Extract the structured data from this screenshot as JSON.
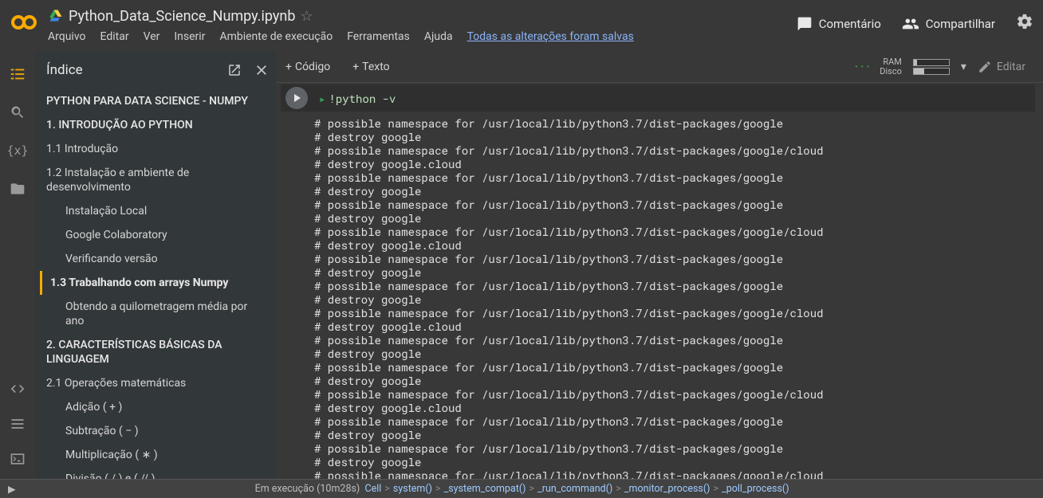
{
  "header": {
    "title": "Python_Data_Science_Numpy.ipynb",
    "menus": [
      "Arquivo",
      "Editar",
      "Ver",
      "Inserir",
      "Ambiente de execução",
      "Ferramentas",
      "Ajuda"
    ],
    "saved_msg": "Todas as alterações foram salvas",
    "comment": "Comentário",
    "share": "Compartilhar"
  },
  "toolbar": {
    "code": "Código",
    "text": "Texto",
    "ram": "RAM",
    "disk": "Disco",
    "edit": "Editar"
  },
  "sidebar": {
    "title": "Índice",
    "items": [
      {
        "lvl": 0,
        "label": "PYTHON PARA DATA SCIENCE - NUMPY"
      },
      {
        "lvl": 0,
        "label": "1. INTRODUÇÃO AO PYTHON"
      },
      {
        "lvl": 1,
        "label": "1.1 Introdução"
      },
      {
        "lvl": 1,
        "label": "1.2 Instalação e ambiente de desenvolvimento"
      },
      {
        "lvl": 2,
        "label": "Instalação Local"
      },
      {
        "lvl": 2,
        "label": "Google Colaboratory"
      },
      {
        "lvl": 2,
        "label": "Verificando versão"
      },
      {
        "lvl": 1,
        "label": "1.3 Trabalhando com arrays Numpy",
        "sel": true
      },
      {
        "lvl": 2,
        "label": "Obtendo a quilometragem média por ano"
      },
      {
        "lvl": 0,
        "label": "2. CARACTERÍSTICAS BÁSICAS DA LINGUAGEM"
      },
      {
        "lvl": 1,
        "label": "2.1 Operações matemáticas"
      },
      {
        "lvl": 2,
        "label": "Adição ( + )"
      },
      {
        "lvl": 2,
        "label": "Subtração ( − )"
      },
      {
        "lvl": 2,
        "label": "Multiplicação ( ∗ )"
      },
      {
        "lvl": 2,
        "label": "Divisão ( / ) e ( // )"
      }
    ]
  },
  "cell": {
    "code_line": "!python -v",
    "output": "# possible namespace for /usr/local/lib/python3.7/dist-packages/google\n# destroy google\n# possible namespace for /usr/local/lib/python3.7/dist-packages/google/cloud\n# destroy google.cloud\n# possible namespace for /usr/local/lib/python3.7/dist-packages/google\n# destroy google\n# possible namespace for /usr/local/lib/python3.7/dist-packages/google\n# destroy google\n# possible namespace for /usr/local/lib/python3.7/dist-packages/google/cloud\n# destroy google.cloud\n# possible namespace for /usr/local/lib/python3.7/dist-packages/google\n# destroy google\n# possible namespace for /usr/local/lib/python3.7/dist-packages/google\n# destroy google\n# possible namespace for /usr/local/lib/python3.7/dist-packages/google/cloud\n# destroy google.cloud\n# possible namespace for /usr/local/lib/python3.7/dist-packages/google\n# destroy google\n# possible namespace for /usr/local/lib/python3.7/dist-packages/google\n# destroy google\n# possible namespace for /usr/local/lib/python3.7/dist-packages/google/cloud\n# destroy google.cloud\n# possible namespace for /usr/local/lib/python3.7/dist-packages/google\n# destroy google\n# possible namespace for /usr/local/lib/python3.7/dist-packages/google\n# destroy google\n# possible namespace for /usr/local/lib/python3.7/dist-packages/google/cloud"
  },
  "status": {
    "exec": "Em execução (10m28s)",
    "crumbs": [
      "Cell",
      "system()",
      "_system_compat()",
      "_run_command()",
      "_monitor_process()",
      "_poll_process()"
    ]
  }
}
